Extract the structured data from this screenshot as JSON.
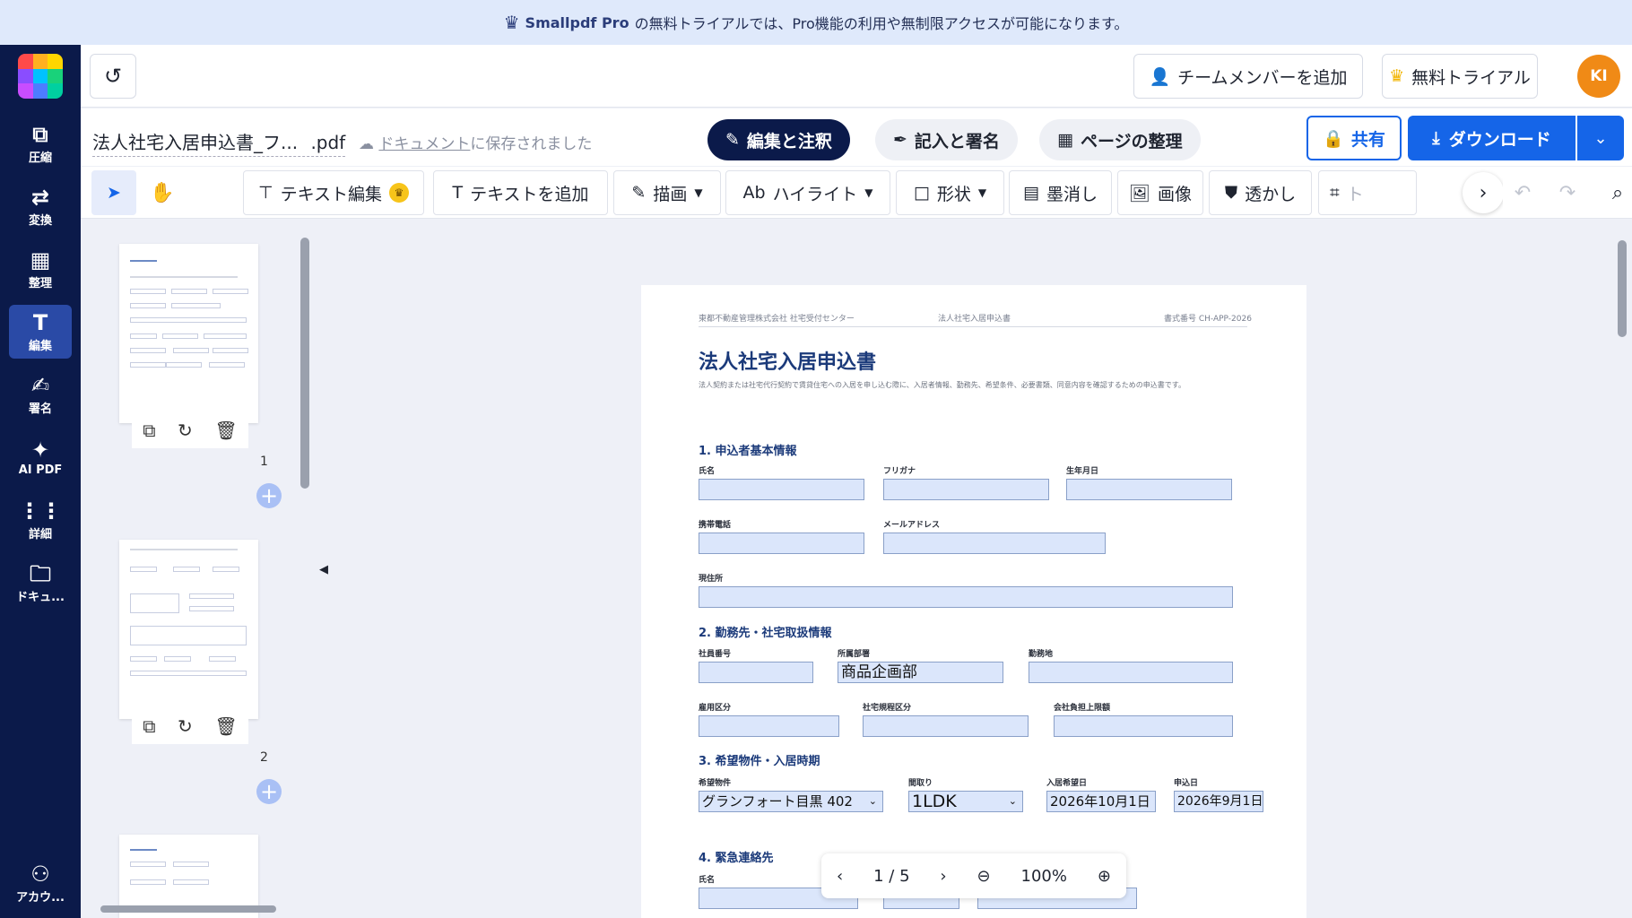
{
  "banner": {
    "brand": "Smallpdf Pro",
    "text": "の無料トライアルでは、Pro機能の利用や無制限アクセスが可能になります。"
  },
  "sidebar": {
    "items": [
      {
        "label": "圧縮",
        "icon": "compress-icon"
      },
      {
        "label": "変換",
        "icon": "convert-icon"
      },
      {
        "label": "整理",
        "icon": "organize-icon"
      },
      {
        "label": "編集",
        "icon": "edit-icon"
      },
      {
        "label": "署名",
        "icon": "sign-icon"
      },
      {
        "label": "AI PDF",
        "icon": "ai-icon"
      },
      {
        "label": "詳細",
        "icon": "grid-icon"
      },
      {
        "label": "ドキュ...",
        "icon": "folder-icon"
      },
      {
        "label": "アカウ...",
        "icon": "user-icon"
      }
    ]
  },
  "topbar": {
    "add_member": "チームメンバーを追加",
    "trial": "無料トライアル",
    "avatar": "KI"
  },
  "docbar": {
    "filename": "法人社宅入居申込書_フ...",
    "ext": ".pdf",
    "saved_link": "ドキュメント",
    "saved_rest": "に保存されました",
    "modes": [
      "編集と注釈",
      "記入と署名",
      "ページの整理"
    ],
    "share": "共有",
    "download": "ダウンロード"
  },
  "toolbar": {
    "text_edit": "テキスト編集",
    "add_text": "テキストを追加",
    "draw": "描画",
    "highlight": "ハイライト",
    "shape": "形状",
    "redact": "墨消し",
    "image": "画像",
    "watermark": "透かし",
    "crop": "ト"
  },
  "thumbs": {
    "page1": "1",
    "page2": "2"
  },
  "doc": {
    "header_left": "東都不動産管理株式会社 社宅受付センター",
    "header_mid": "法人社宅入居申込書",
    "header_right": "書式番号 CH-APP-2026",
    "title": "法人社宅入居申込書",
    "desc": "法人契約または社宅代行契約で賃貸住宅への入居を申し込む際に、入居者情報、勤務先、希望条件、必要書類、同意内容を確認するための申込書です。",
    "sec1": "1. 申込者基本情報",
    "sec2": "2. 勤務先・社宅取扱情報",
    "sec3": "3. 希望物件・入居時期",
    "sec4": "4. 緊急連絡先",
    "labels": {
      "name": "氏名",
      "furigana": "フリガナ",
      "birth": "生年月日",
      "mobile": "携帯電話",
      "email": "メールアドレス",
      "address": "現住所",
      "emp_no": "社員番号",
      "dept": "所属部署",
      "workplace": "勤務地",
      "emp_type": "雇用区分",
      "rule": "社宅規程区分",
      "limit": "会社負担上限額",
      "property": "希望物件",
      "layout": "間取り",
      "move_date": "入居希望日",
      "apply_date": "申込日",
      "ec_name": "氏名"
    },
    "values": {
      "dept": "商品企画部",
      "property": "グランフォート目黒 402",
      "layout": "1LDK",
      "move_date": "2026年10月1日",
      "apply_date": "2026年9月1日"
    }
  },
  "zoom": {
    "current_page": "1",
    "sep": "/",
    "total_pages": "5",
    "zoom": "100%"
  }
}
